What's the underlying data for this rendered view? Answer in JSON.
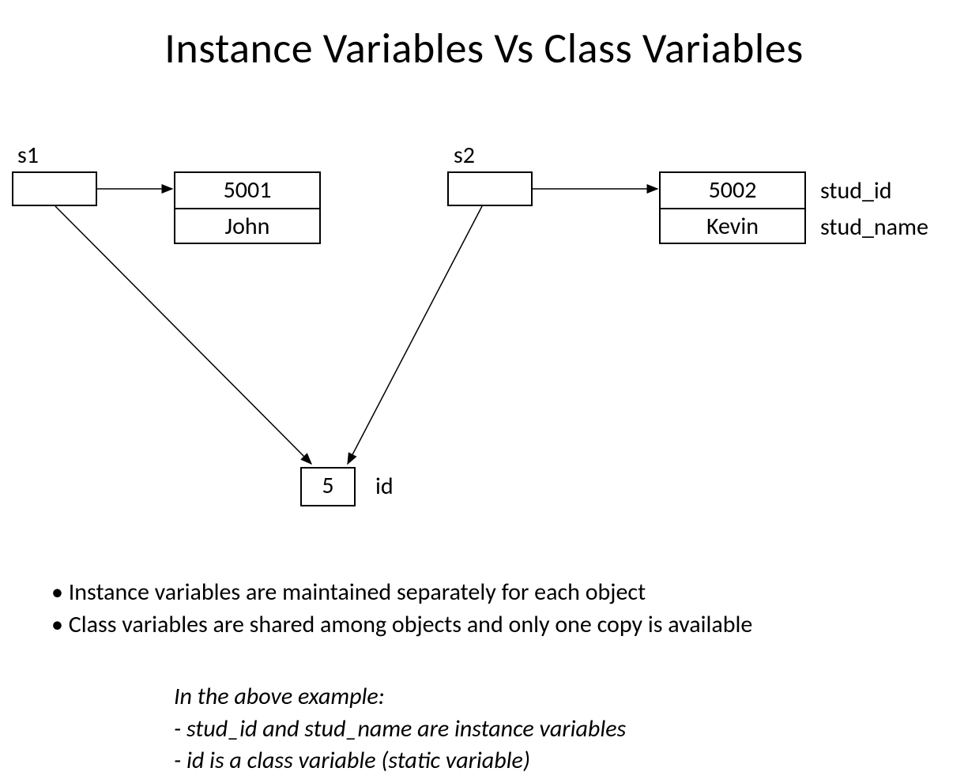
{
  "title": "Instance Variables Vs Class Variables",
  "diagram": {
    "s1": {
      "label": "s1",
      "stud_id": "5001",
      "stud_name": "John"
    },
    "s2": {
      "label": "s2",
      "stud_id": "5002",
      "stud_name": "Kevin"
    },
    "field_labels": {
      "stud_id": "stud_id",
      "stud_name": "stud_name"
    },
    "class_var": {
      "value": "5",
      "label": "id"
    }
  },
  "bullets": [
    "Instance variables are maintained separately for each object",
    "Class variables are shared among objects and only one copy is available"
  ],
  "example_note": {
    "line1": "In the above example:",
    "line2": "- stud_id and stud_name are instance variables",
    "line3": "- id is a class variable (static variable)"
  }
}
